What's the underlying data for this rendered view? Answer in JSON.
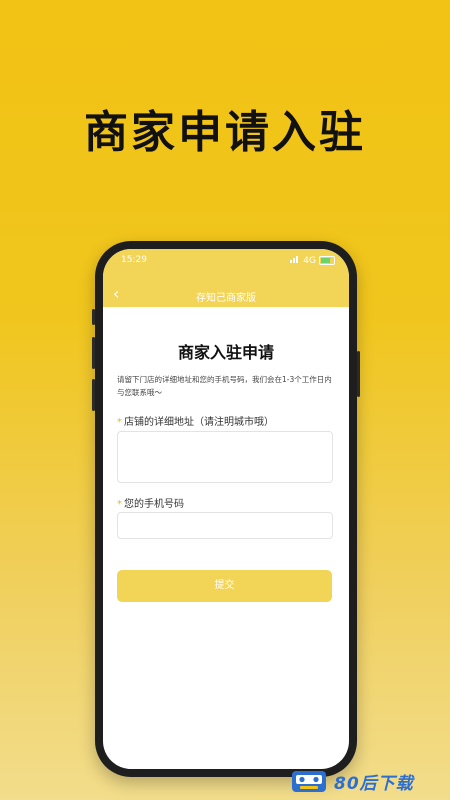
{
  "promo": {
    "headline": "商家申请入驻"
  },
  "status_bar": {
    "time": "15:29",
    "signal": "4G"
  },
  "nav": {
    "back_glyph": "‹",
    "title": "存知己商家版"
  },
  "form": {
    "title": "商家入驻申请",
    "description": "请留下门店的详细地址和您的手机号码，我们会在1-3个工作日内与您联系哦～",
    "address_label": "店铺的详细地址（请注明城市哦）",
    "address_value": "",
    "phone_label": "您的手机号码",
    "phone_value": "",
    "required_marker": "*",
    "submit_label": "提交"
  },
  "watermark": {
    "text": "80后下载"
  },
  "colors": {
    "accent": "#f2d457",
    "background": "#f2c214",
    "watermark": "#2d6fd1"
  }
}
